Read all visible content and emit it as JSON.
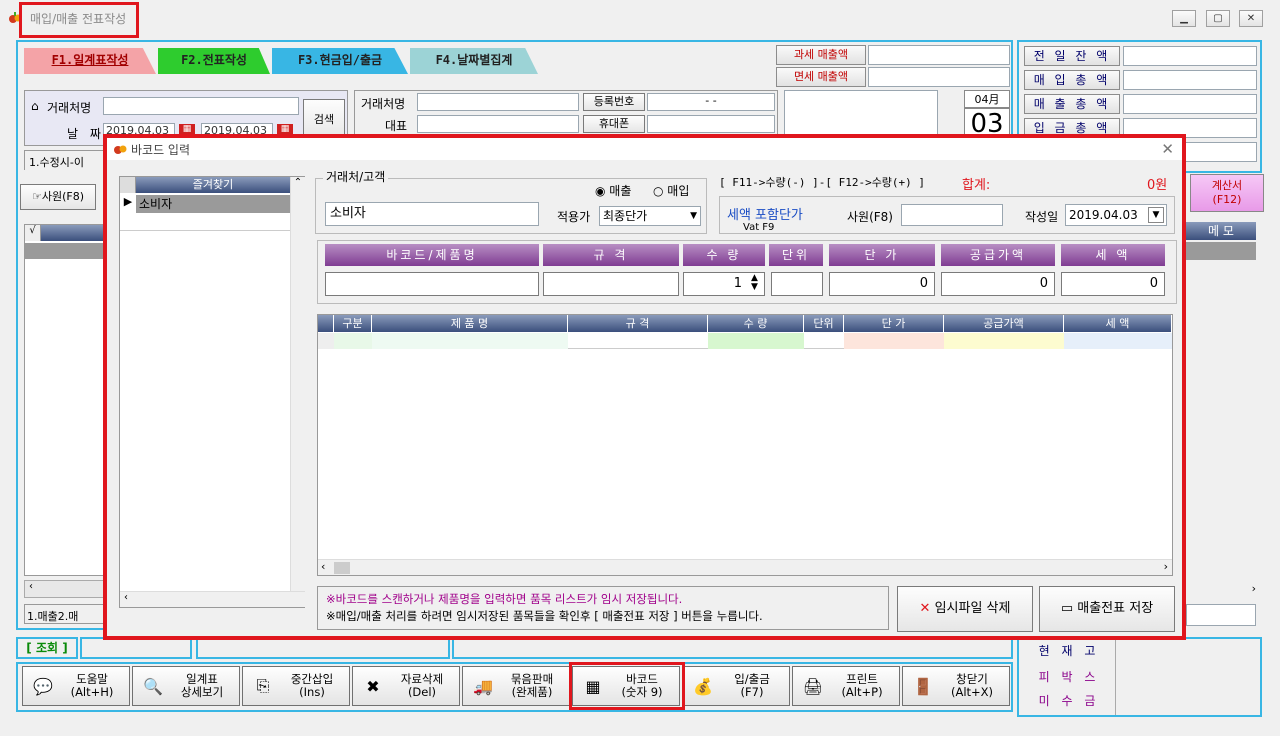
{
  "window": {
    "title": "매입/매출 전표작성",
    "min": "▭",
    "max": "▣",
    "close": "✕"
  },
  "tabs": [
    {
      "label": "F1.일계표작성"
    },
    {
      "label": "F2.전표작성"
    },
    {
      "label": "F3.현금입/출금"
    },
    {
      "label": "F4.날짜별집계"
    }
  ],
  "tax_labels": {
    "taxed": "과세 매출액",
    "exempt": "면세 매출액"
  },
  "summary": [
    "전 일 잔 액",
    "매 입 총 액",
    "매 출 총 액",
    "입 금 총 액"
  ],
  "client": {
    "label": "거래처명",
    "date_label": "날 짜",
    "date_from": "2019.04.03",
    "date_to": "2019.04.03",
    "search": "검색",
    "cal_icon": "달력"
  },
  "client_info": {
    "name": "거래처명",
    "rep": "대표",
    "reg_no": "등록번호",
    "reg_value": "-  -",
    "phone": "휴대폰"
  },
  "date_box": {
    "month": "04月",
    "day": "03"
  },
  "left_tab": "1.수정시-이",
  "left_bottom_tabs": [
    "1.매출",
    "2.매"
  ],
  "employee_btn": "사원(F8)",
  "calc_btn": {
    "line1": "계산서",
    "line2": "(F12)"
  },
  "memo": "메 모",
  "lookup": "[ 조회 ]",
  "bottom_right": [
    "현 재 고",
    "피 박 스",
    "미 수 금"
  ],
  "bottom_buttons": [
    {
      "name": "help",
      "l1": "도움말",
      "l2": "(Alt+H)",
      "icon": "💬"
    },
    {
      "name": "daily-detail",
      "l1": "일계표",
      "l2": "상세보기",
      "icon": "🔍"
    },
    {
      "name": "insert",
      "l1": "중간삽입",
      "l2": "(Ins)",
      "icon": "⎘"
    },
    {
      "name": "delete",
      "l1": "자료삭제",
      "l2": "(Del)",
      "icon": "✖"
    },
    {
      "name": "bundle",
      "l1": "묶음판매",
      "l2": "(완제품)",
      "icon": "🚚"
    },
    {
      "name": "barcode",
      "l1": "바코드",
      "l2": "(숫자 9)",
      "icon": "▦"
    },
    {
      "name": "cash",
      "l1": "입/출금",
      "l2": "(F7)",
      "icon": "💰"
    },
    {
      "name": "print",
      "l1": "프린트",
      "l2": "(Alt+P)",
      "icon": "🖨"
    },
    {
      "name": "close",
      "l1": "창닫기",
      "l2": "(Alt+X)",
      "icon": "🚪"
    }
  ],
  "dialog": {
    "title": "바코드 입력",
    "favorites_header": "즐겨찾기",
    "favorites": [
      "소비자"
    ],
    "client_group": "거래처/고객",
    "client_value": "소비자",
    "radio_sale": "매출",
    "radio_purchase": "매입",
    "price_label": "적용가",
    "price_value": "최종단가",
    "hint": "[ F11->수량(-) ]-[ F12->수량(+) ]",
    "total_label": "합계:",
    "total_value": "0원",
    "vat_label": "세액 포함단가",
    "vat_key": "Vat F9",
    "employee_label": "사원(F8)",
    "date_label": "작성일",
    "date_value": "2019.04.03",
    "product_headers": [
      "바코드/제품명",
      "규 격",
      "수 량",
      "단위",
      "단 가",
      "공급가액",
      "세 액"
    ],
    "qty": "1",
    "unit_price": "0",
    "supply": "0",
    "tax": "0",
    "grid_headers": [
      "구분",
      "제 품 명",
      "규 격",
      "수 량",
      "단위",
      "단 가",
      "공급가액",
      "세 액"
    ],
    "note1": "※바코드를 스캔하거나 제품명을 입력하면 품목 리스트가 임시 저장됩니다.",
    "note2": "※매입/매출 처리를 하려면 임시저장된 품목들을 확인후 [ 매출전표 저장 ] 버튼을 누릅니다.",
    "delete_btn": "임시파일 삭제",
    "save_btn": "매출전표 저장"
  },
  "colors": {
    "accent_blue": "#38b6e4",
    "highlight_red": "#e0161d",
    "header_purple": "#7f3c92",
    "grid_header": "#3b4f7c"
  }
}
